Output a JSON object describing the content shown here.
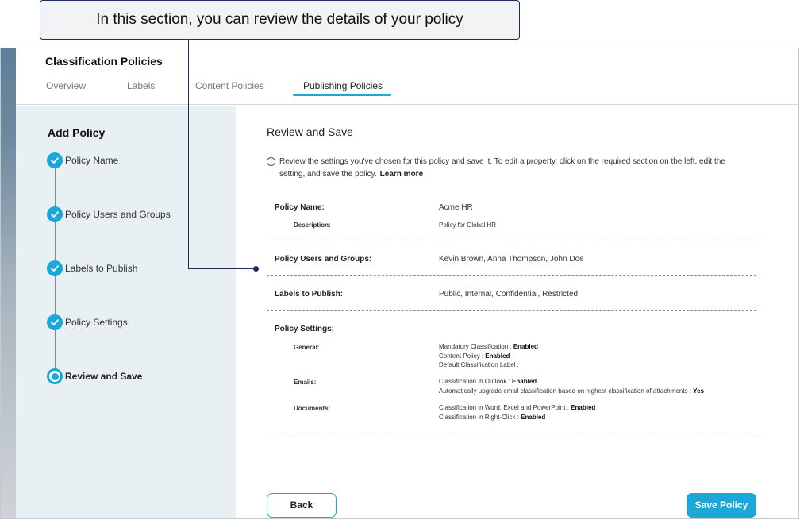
{
  "callout": {
    "text": "In this section, you can review the details of your policy"
  },
  "header": {
    "title": "Classification Policies",
    "tabs": [
      {
        "label": "Overview"
      },
      {
        "label": "Labels"
      },
      {
        "label": "Content Policies"
      },
      {
        "label": "Publishing Policies",
        "active": true
      }
    ]
  },
  "sidebar": {
    "title": "Add Policy",
    "steps": [
      {
        "label": "Policy Name",
        "status": "complete"
      },
      {
        "label": "Policy Users and Groups",
        "status": "complete"
      },
      {
        "label": "Labels to Publish",
        "status": "complete"
      },
      {
        "label": "Policy Settings",
        "status": "complete"
      },
      {
        "label": "Review and Save",
        "status": "current"
      }
    ]
  },
  "main": {
    "title": "Review and Save",
    "info_text": "Review the settings you've chosen for this policy and save it. To edit a property, click on the required section on the left, edit the setting, and save the policy.",
    "learn_more": "Learn more",
    "policy_name": {
      "label": "Policy Name:",
      "value": "Acme HR"
    },
    "description": {
      "label": "Description:",
      "value": "Policy for Global HR"
    },
    "users_groups": {
      "label": "Policy Users and Groups:",
      "value": "Kevin Brown, Anna Thompson, John Doe"
    },
    "labels_publish": {
      "label": "Labels to Publish:",
      "value": "Public, Internal, Confidential, Restricted"
    },
    "settings": {
      "label": "Policy Settings:",
      "general": {
        "label": "General:",
        "lines": [
          {
            "text": "Mandatory Classification : ",
            "value": "Enabled"
          },
          {
            "text": "Content Policy : ",
            "value": "Enabled"
          },
          {
            "text": "Default Classification Label :",
            "value": ""
          }
        ]
      },
      "emails": {
        "label": "Emails:",
        "lines": [
          {
            "text": "Classification in Outlook : ",
            "value": "Enabled"
          },
          {
            "text": "Automatically upgrade email classification based on highest classification of attachments : ",
            "value": "Yes"
          }
        ]
      },
      "documents": {
        "label": "Documents:",
        "lines": [
          {
            "text": "Classification in Word, Excel and PowerPoint : ",
            "value": "Enabled"
          },
          {
            "text": "Classification in Right-Click : ",
            "value": "Enabled"
          }
        ]
      }
    },
    "back_label": "Back",
    "save_label": "Save Policy"
  },
  "colors": {
    "accent": "#1ba8d8",
    "sidebar_bg": "#e8f0f4",
    "callout_border": "#1f2d5a"
  }
}
